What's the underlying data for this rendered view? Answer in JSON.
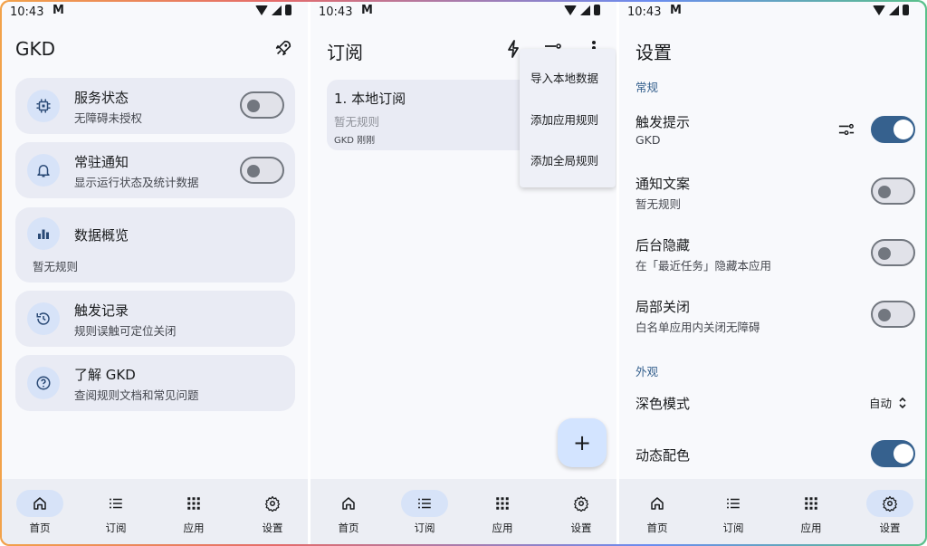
{
  "status": {
    "time": "10:43",
    "indicator": "M"
  },
  "home": {
    "title": "GKD",
    "rocket_icon": "rocket-icon",
    "cards": [
      {
        "title": "服务状态",
        "subtitle": "无障碍未授权",
        "icon": "chip-icon",
        "switch_on": false
      },
      {
        "title": "常驻通知",
        "subtitle": "显示运行状态及统计数据",
        "icon": "bell-icon",
        "switch_on": false
      },
      {
        "title": "数据概览",
        "subtitle": "暂无规则",
        "icon": "bar-chart-icon"
      },
      {
        "title": "触发记录",
        "subtitle": "规则误触可定位关闭",
        "icon": "history-icon"
      },
      {
        "title": "了解 GKD",
        "subtitle": "查阅规则文档和常见问题",
        "icon": "help-icon"
      }
    ]
  },
  "subscription": {
    "title": "订阅",
    "item": {
      "name": "1. 本地订阅",
      "rules": "暂无规则",
      "meta": "GKD  刚刚"
    },
    "menu": [
      "导入本地数据",
      "添加应用规则",
      "添加全局规则"
    ],
    "fab_label": "+"
  },
  "settings": {
    "title": "设置",
    "section_general": "常规",
    "section_appearance": "外观",
    "items": [
      {
        "title": "触发提示",
        "subtitle": "GKD",
        "switch_on": true
      },
      {
        "title": "通知文案",
        "subtitle": "暂无规则",
        "switch_on": false
      },
      {
        "title": "后台隐藏",
        "subtitle": "在「最近任务」隐藏本应用",
        "switch_on": false
      },
      {
        "title": "局部关闭",
        "subtitle": "白名单应用内关闭无障碍",
        "switch_on": false
      }
    ],
    "dark_mode": {
      "title": "深色模式",
      "value": "自动"
    },
    "dynamic_color": {
      "title": "动态配色",
      "switch_on": true
    }
  },
  "nav": {
    "items": [
      {
        "label": "首页",
        "icon": "home-icon"
      },
      {
        "label": "订阅",
        "icon": "list-icon"
      },
      {
        "label": "应用",
        "icon": "apps-icon"
      },
      {
        "label": "设置",
        "icon": "gear-icon"
      }
    ]
  },
  "colors": {
    "accent": "#36618e",
    "card": "#e9ebf4",
    "icon_bg": "#d7e3f8"
  }
}
